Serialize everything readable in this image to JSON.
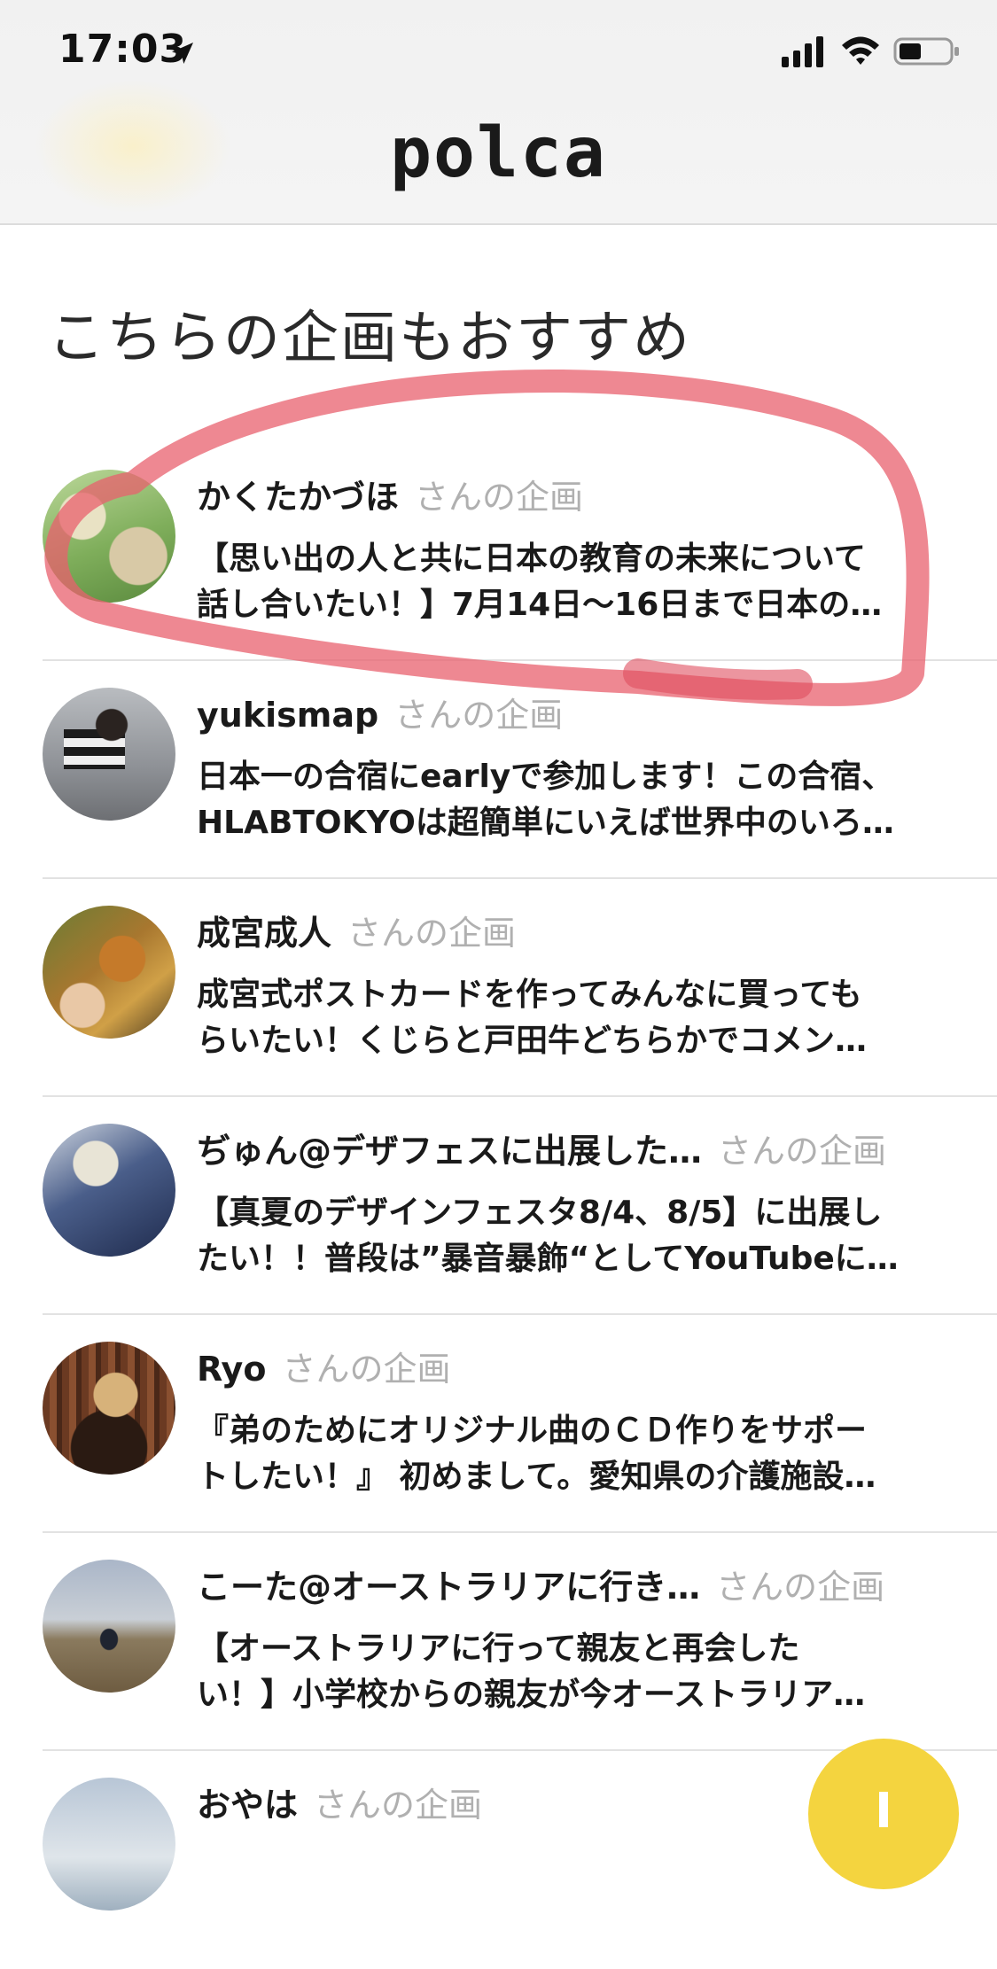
{
  "status_bar": {
    "time": "17:03",
    "icons": [
      "location-arrow-icon",
      "cellular-signal-icon",
      "wifi-icon",
      "battery-icon"
    ]
  },
  "header": {
    "logo": "polca"
  },
  "section": {
    "title": "こちらの企画もおすすめ"
  },
  "suffix": "さんの企画",
  "items": [
    {
      "author": "かくたかづほ",
      "line1": "【思い出の人と共に日本の教育の未来について",
      "line2": "話し合いたい！】7月14日〜16日まで日本の…"
    },
    {
      "author": "yukismap",
      "line1": "日本一の合宿にearlyで参加します！この合宿、",
      "line2": "HLABTOKYOは超簡単にいえば世界中のいろ…"
    },
    {
      "author": "成宮成人",
      "line1": "成宮式ポストカードを作ってみんなに買っても",
      "line2": "らいたい！くじらと戸田牛どちらかでコメン…"
    },
    {
      "author": "ぢゅん@デザフェスに出展した…",
      "line1": "【真夏のデザインフェスタ8/4、8/5】に出展し",
      "line2": "たい！！普段は”暴音暴飾“としてYouTubeに…"
    },
    {
      "author": "Ryo",
      "line1": "『弟のためにオリジナル曲のＣＤ作りをサポー",
      "line2": "トしたい！』 初めまして。愛知県の介護施設…"
    },
    {
      "author": "こーた@オーストラリアに行き…",
      "line1": "【オーストラリアに行って親友と再会した",
      "line2": "い！】小学校からの親友が今オーストラリア…"
    },
    {
      "author": "おやは",
      "line1": "",
      "line2": ""
    }
  ],
  "colors": {
    "accent_yellow": "#f4d43f",
    "annotation_red": "#e8606e",
    "muted_text": "#b0b0b0"
  }
}
